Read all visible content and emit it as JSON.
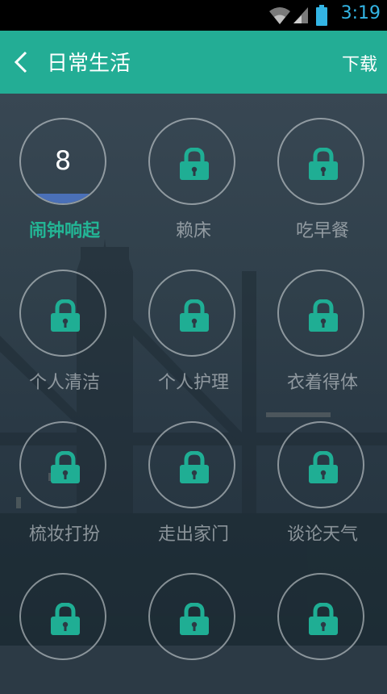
{
  "status_bar": {
    "time": "3:19",
    "icons": [
      "wifi-icon",
      "signal-icon",
      "battery-icon"
    ],
    "accent": "#33b5e5"
  },
  "header": {
    "back_icon": "chevron-left-icon",
    "title": "日常生活",
    "download_label": "下载",
    "color": "#23ad95"
  },
  "grid": {
    "items": [
      {
        "label": "闹钟响起",
        "locked": false,
        "count": "8",
        "progress": 0.12
      },
      {
        "label": "赖床",
        "locked": true
      },
      {
        "label": "吃早餐",
        "locked": true
      },
      {
        "label": "个人清洁",
        "locked": true
      },
      {
        "label": "个人护理",
        "locked": true
      },
      {
        "label": "衣着得体",
        "locked": true
      },
      {
        "label": "梳妆打扮",
        "locked": true
      },
      {
        "label": "走出家门",
        "locked": true
      },
      {
        "label": "谈论天气",
        "locked": true
      },
      {
        "label": "",
        "locked": true
      },
      {
        "label": "",
        "locked": true
      },
      {
        "label": "",
        "locked": true
      }
    ],
    "lock_icon": "lock-icon",
    "lock_color": "#1fae94",
    "active_color": "#23b595",
    "progress_color": "#4a70b8"
  }
}
